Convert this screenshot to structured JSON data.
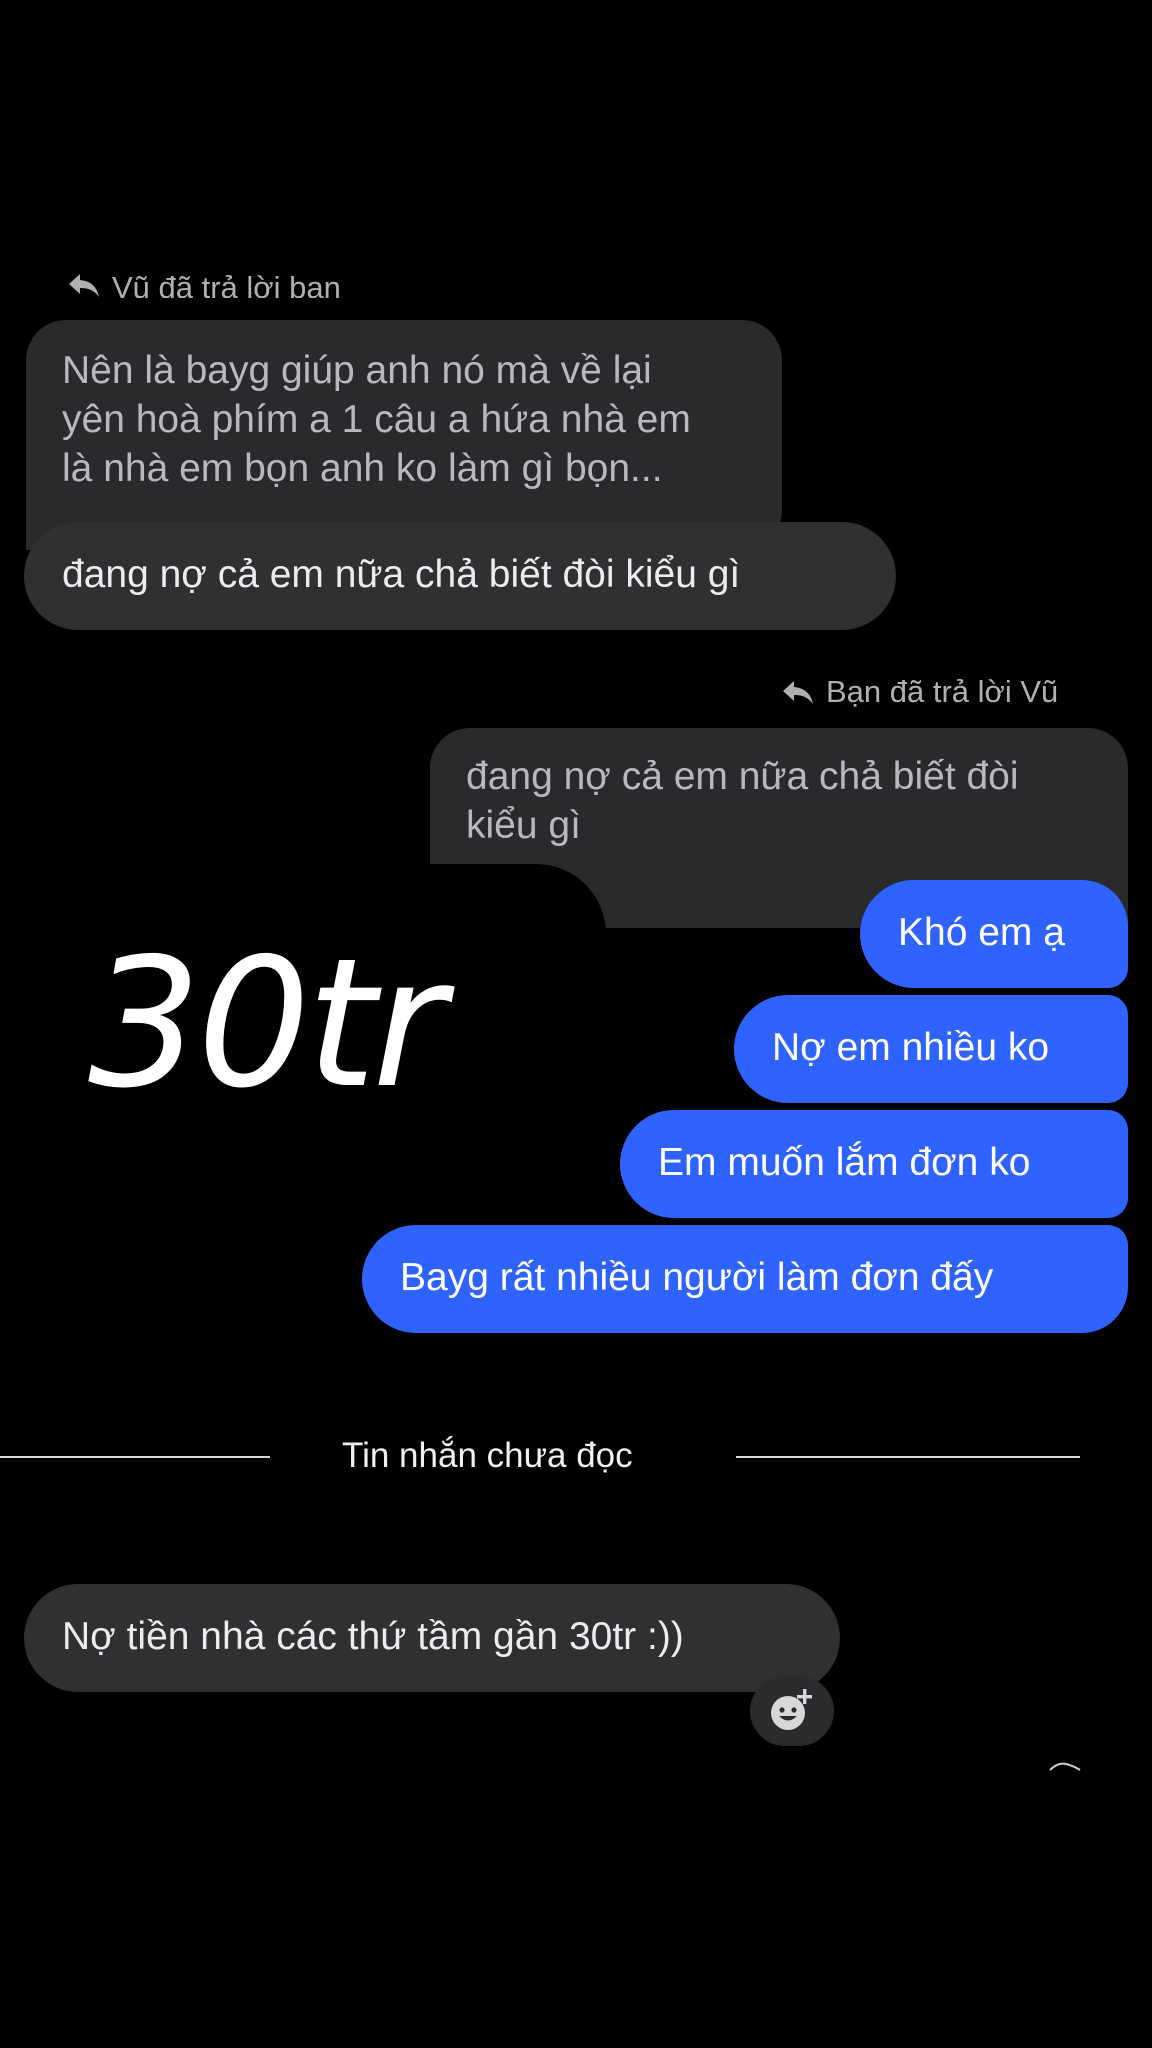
{
  "thread": {
    "reply_header_1": "Vũ đã trả lời bạn",
    "incoming_quote_lines": [
      "Nên là bayg giúp anh nó mà về lại",
      "yên hoà phím a 1 câu a hứa nhà em",
      "là nhà em bọn anh ko làm gì bọn..."
    ],
    "incoming_reply": "đang nợ cả em nữa chả biết đòi kiểu gì",
    "reply_header_2": "Bạn đã trả lời Vũ",
    "outgoing_quote_lines": [
      "đang nợ cả em nữa chả biết đòi",
      "kiểu gì"
    ],
    "outgoing_messages": [
      "Khó em ạ",
      "Nợ em nhiều ko",
      "Em muốn lắm đơn ko",
      "Bayg rất nhiều người làm đơn đấy"
    ],
    "unread_divider": "Tin nhắn chưa đọc",
    "last_incoming": "Nợ tiền nhà các thứ tầm gần 30tr :))"
  },
  "overlay": {
    "handwritten_text": "30tr"
  },
  "icons": {
    "reply": "reply-arrow-icon",
    "reaction": "add-reaction-icon"
  },
  "colors": {
    "background": "#000000",
    "incoming_bubble": "#303033",
    "quote_bubble": "#2a2a2d",
    "outgoing_bubble": "#2f63ff"
  }
}
